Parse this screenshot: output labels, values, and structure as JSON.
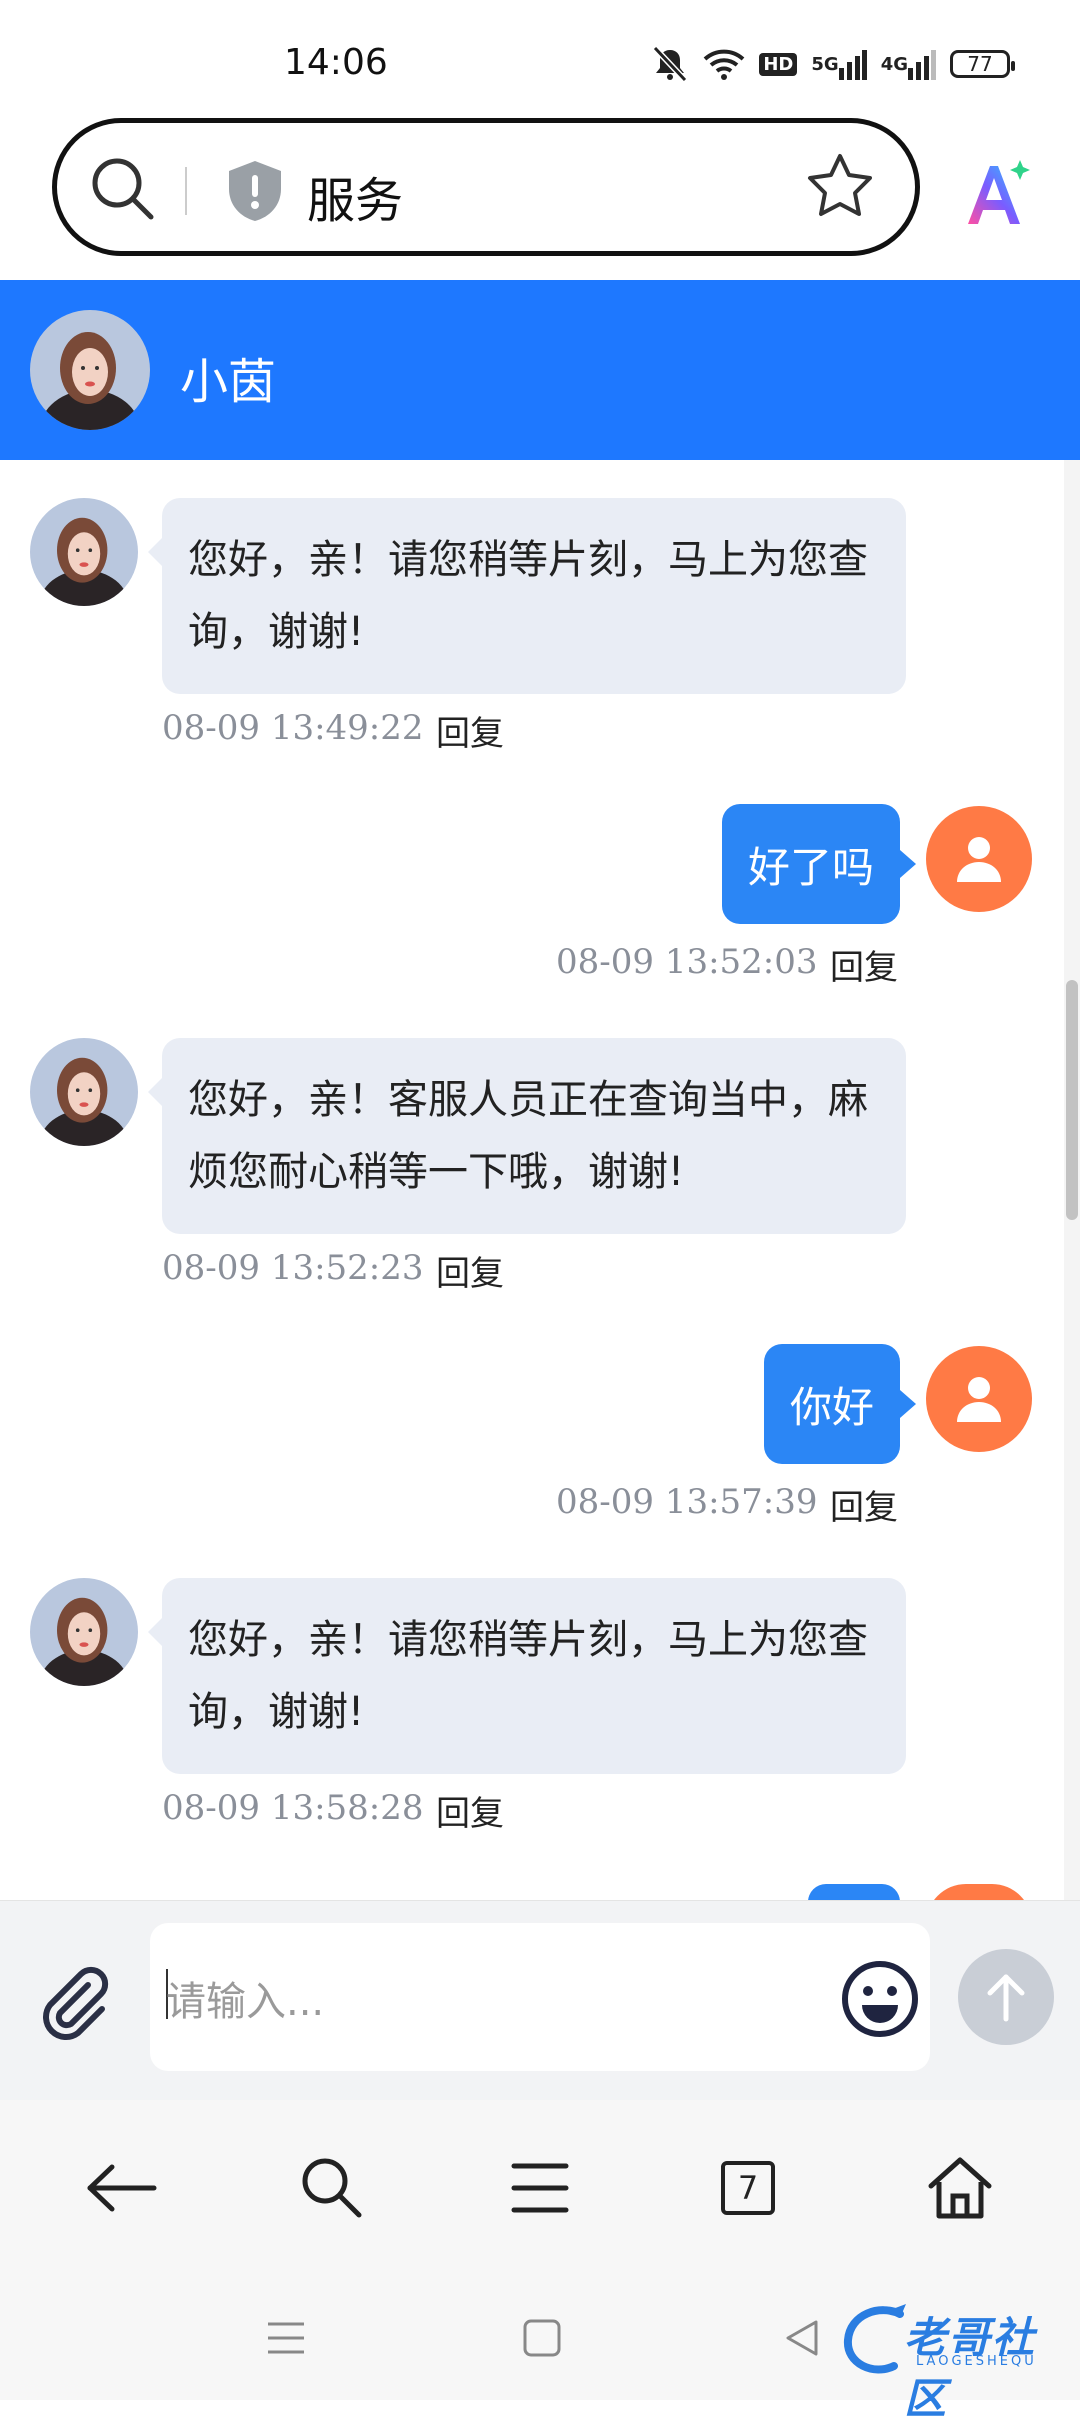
{
  "status_bar": {
    "time": "14:06",
    "hd_label": "HD",
    "net1": "5G",
    "net2": "4G",
    "battery": "77"
  },
  "browser": {
    "search_text": "服务",
    "tab_count": "7"
  },
  "chat": {
    "agent_name": "小茵",
    "messages": [
      {
        "side": "in",
        "text": "您好，亲！请您稍等片刻，马上为您查询，谢谢!",
        "time": "08-09 13:49:22",
        "reply": "回复"
      },
      {
        "side": "out",
        "text": "好了吗",
        "time": "08-09 13:52:03",
        "reply": "回复"
      },
      {
        "side": "in",
        "text": "您好，亲！客服人员正在查询当中，麻烦您耐心稍等一下哦，谢谢!",
        "time": "08-09 13:52:23",
        "reply": "回复"
      },
      {
        "side": "out",
        "text": "你好",
        "time": "08-09 13:57:39",
        "reply": "回复"
      },
      {
        "side": "in",
        "text": "您好，亲！请您稍等片刻，马上为您查询，谢谢!",
        "time": "08-09 13:58:28",
        "reply": "回复"
      }
    ],
    "input_placeholder": "请输入..."
  },
  "watermark": {
    "text": "老哥社区",
    "sub": "LAOGESHEQU"
  },
  "colors": {
    "header_blue": "#1e78ff",
    "bubble_out": "#2b86f5",
    "bubble_in": "#e9edf5",
    "user_avatar": "#ff7a45"
  },
  "icons": [
    "search-icon",
    "shield-icon",
    "star-icon",
    "ai-icon",
    "attach-icon",
    "emoji-icon",
    "send-icon",
    "back-icon",
    "menu-icon",
    "home-icon"
  ]
}
